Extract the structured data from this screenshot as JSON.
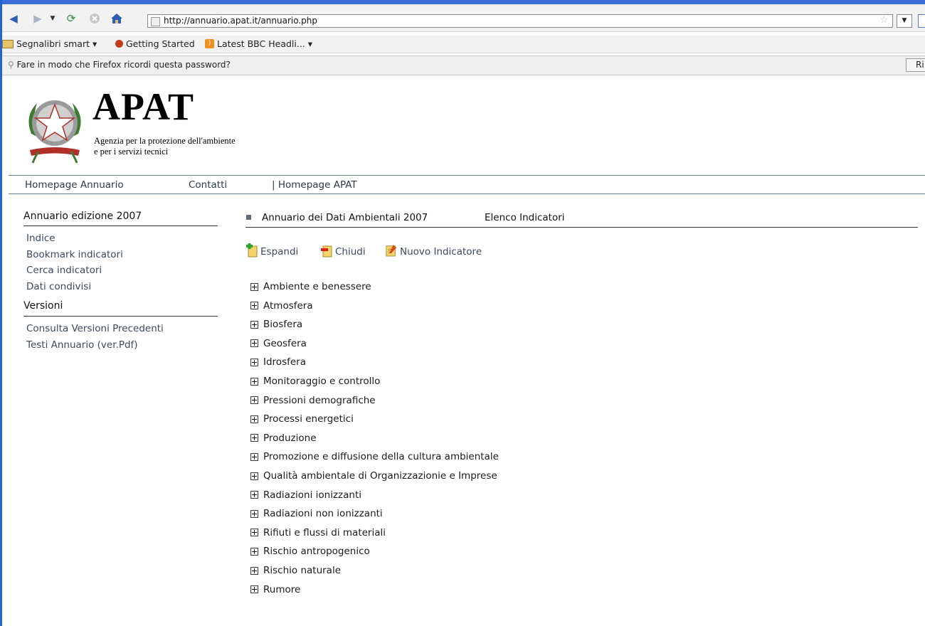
{
  "browser": {
    "url": "http://annuario.apat.it/annuario.php",
    "bookmarks": [
      {
        "label": "Segnalibri smart ▾",
        "icon": "folder-icon"
      },
      {
        "label": "Getting Started",
        "icon": "firefox-icon"
      },
      {
        "label": "Latest BBC Headli... ▾",
        "icon": "rss-icon"
      }
    ],
    "password_prompt": "Fare in modo che Firefox ricordi questa password?",
    "password_button": "Ri"
  },
  "header": {
    "title": "APAT",
    "subtitle_line1": "Agenzia per la protezione dell'ambiente",
    "subtitle_line2": "e per i servizi tecnici"
  },
  "topmenu": [
    {
      "label": "Homepage Annuario"
    },
    {
      "label": "Contatti"
    },
    {
      "label": "| Homepage APAT"
    }
  ],
  "sidebar": {
    "section1": {
      "title": "Annuario edizione 2007",
      "links": [
        "Indice",
        "Bookmark indicatori",
        "Cerca indicatori",
        "Dati condivisi"
      ]
    },
    "section2": {
      "title": "Versioni",
      "links": [
        "Consulta Versioni Precedenti",
        "Testi Annuario (ver.Pdf)"
      ]
    }
  },
  "main": {
    "breadcrumb": [
      "Annuario dei Dati Ambientali 2007",
      "Elenco Indicatori"
    ],
    "actions": [
      {
        "label": "Espandi",
        "icon": "expand-icon"
      },
      {
        "label": "Chiudi",
        "icon": "collapse-icon"
      },
      {
        "label": "Nuovo Indicatore",
        "icon": "new-indicator-icon"
      }
    ],
    "tree": [
      "Ambiente e benessere",
      "Atmosfera",
      "Biosfera",
      "Geosfera",
      "Idrosfera",
      "Monitoraggio e controllo",
      "Pressioni demografiche",
      "Processi energetici",
      "Produzione",
      "Promozione e diffusione della cultura ambientale",
      "Qualità ambientale di Organizzazionie e Imprese",
      "Radiazioni ionizzanti",
      "Radiazioni non ionizzanti",
      "Rifiuti e flussi di materiali",
      "Rischio antropogenico",
      "Rischio naturale",
      "Rumore"
    ]
  }
}
